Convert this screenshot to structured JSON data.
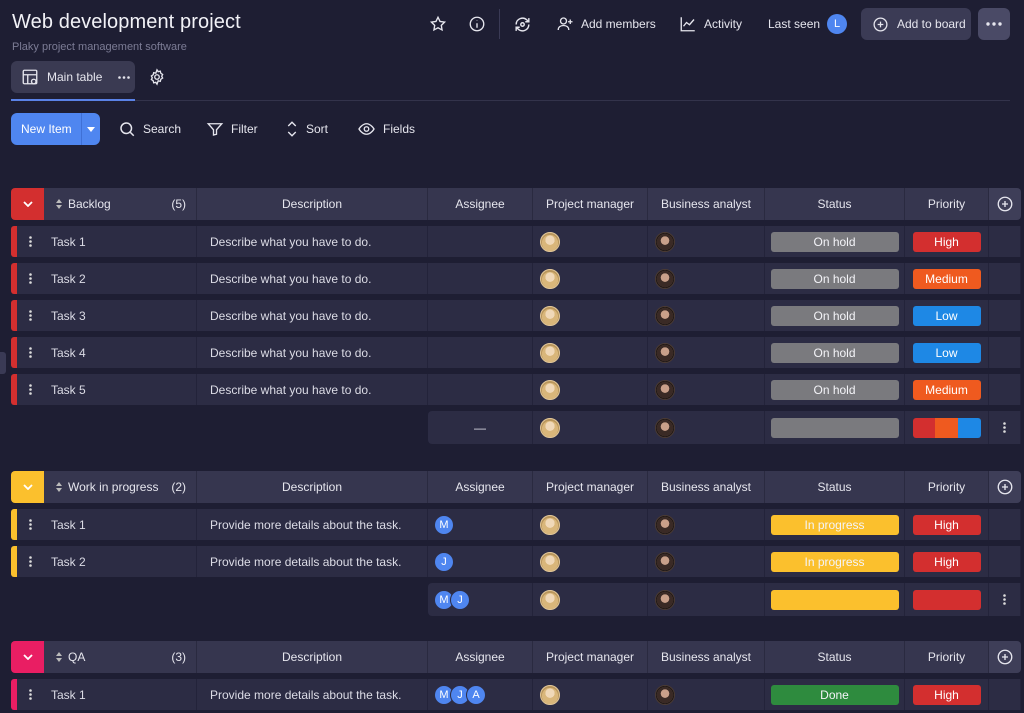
{
  "header": {
    "title": "Web development project",
    "subtitle": "Plaky project management software",
    "add_members": "Add members",
    "activity": "Activity",
    "last_seen": "Last seen",
    "last_seen_initial": "L",
    "add_to_board": "Add to board"
  },
  "view": {
    "tab_label": "Main table"
  },
  "toolbar": {
    "new_item": "New Item",
    "search": "Search",
    "filter": "Filter",
    "sort": "Sort",
    "fields": "Fields"
  },
  "columns": {
    "description": "Description",
    "assignee": "Assignee",
    "project_manager": "Project manager",
    "business_analyst": "Business analyst",
    "status": "Status",
    "priority": "Priority"
  },
  "colors": {
    "on_hold": "#7a7a7e",
    "in_progress": "#fbc02d",
    "done": "#2e8b3e",
    "high": "#d32f2f",
    "medium": "#ef5a1f",
    "low": "#1e88e5",
    "backlog": "#d32f2f",
    "wip": "#fbc02d",
    "qa": "#e91e63"
  },
  "groups": [
    {
      "name": "Backlog",
      "count": "(5)",
      "summary_dash": "—",
      "rows": [
        {
          "task": "Task 1",
          "desc": "Describe what you have to do.",
          "status": "On hold",
          "priority": "High"
        },
        {
          "task": "Task 2",
          "desc": "Describe what you have to do.",
          "status": "On hold",
          "priority": "Medium"
        },
        {
          "task": "Task 3",
          "desc": "Describe what you have to do.",
          "status": "On hold",
          "priority": "Low"
        },
        {
          "task": "Task 4",
          "desc": "Describe what you have to do.",
          "status": "On hold",
          "priority": "Low"
        },
        {
          "task": "Task 5",
          "desc": "Describe what you have to do.",
          "status": "On hold",
          "priority": "Medium"
        }
      ]
    },
    {
      "name": "Work in progress",
      "count": "(2)",
      "rows": [
        {
          "task": "Task 1",
          "desc": "Provide more details about the task.",
          "assignee": "M",
          "status": "In progress",
          "priority": "High"
        },
        {
          "task": "Task 2",
          "desc": "Provide more details about the task.",
          "assignee": "J",
          "status": "In progress",
          "priority": "High"
        }
      ],
      "summary_assignees": [
        "M",
        "J"
      ]
    },
    {
      "name": "QA",
      "count": "(3)",
      "rows": [
        {
          "task": "Task 1",
          "desc": "Provide more details about the task.",
          "assignees": [
            "M",
            "J",
            "A"
          ],
          "status": "Done",
          "priority": "High"
        }
      ]
    }
  ]
}
